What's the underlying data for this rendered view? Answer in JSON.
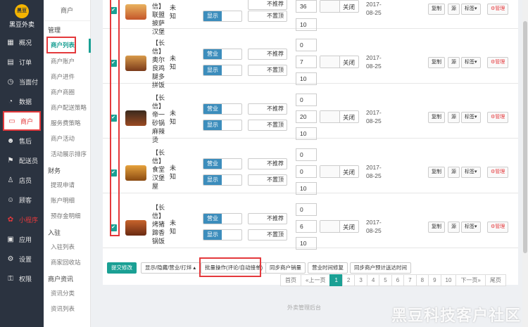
{
  "brand": {
    "logo_text": "黑豆",
    "name": "黑豆外卖"
  },
  "nav": [
    {
      "icon": "▦",
      "label": "概况"
    },
    {
      "icon": "▤",
      "label": "订单"
    },
    {
      "icon": "◷",
      "label": "当面付"
    },
    {
      "icon": "◔",
      "label": "数据"
    },
    {
      "icon": "▭",
      "label": "商户"
    },
    {
      "icon": "☻",
      "label": "售后"
    },
    {
      "icon": "⚑",
      "label": "配送员"
    },
    {
      "icon": "♙",
      "label": "店员"
    },
    {
      "icon": "☺",
      "label": "顾客"
    },
    {
      "icon": "✿",
      "label": "小程序"
    },
    {
      "icon": "▣",
      "label": "应用"
    },
    {
      "icon": "⚙",
      "label": "设置"
    },
    {
      "icon": "⚿",
      "label": "权限"
    }
  ],
  "sub": {
    "title": "商户",
    "groups": [
      {
        "label": "管理",
        "items": [
          "商户列表",
          "商户账户",
          "商户进件",
          "商户商圈",
          "商户配送策略",
          "服务费策略",
          "商户活动",
          "活动展示排序"
        ]
      },
      {
        "label": "财务",
        "items": [
          "提现申请",
          "账户明细",
          "预存金明细"
        ]
      },
      {
        "label": "入驻",
        "items": [
          "入驻列表",
          "商家回收站"
        ]
      },
      {
        "label": "商户资讯",
        "items": [
          "资讯分类",
          "资讯列表"
        ]
      }
    ]
  },
  "row0": {
    "name": "信】联盟披萨汉堡",
    "wz": "未知",
    "show": "显示",
    "top": "不置顶",
    "rec": "不推荐",
    "n1": "36",
    "n2": "10",
    "close": "关闭",
    "date": "2017-08-25",
    "b1": "复制",
    "b2": "源",
    "b3": "标签▾",
    "b4": "⚙管理"
  },
  "rows": [
    {
      "name": "【长信】奥尔良鸡腿多拼饭",
      "wz": "未知",
      "open": "营业",
      "rec": "不推荐",
      "show": "显示",
      "top": "不置顶",
      "n0": "0",
      "n1": "7",
      "n2": "10",
      "close": "关闭",
      "date": "2017-08-25"
    },
    {
      "name": "【长信】帝一砂锅麻辣烫",
      "wz": "未知",
      "open": "营业",
      "rec": "不推荐",
      "show": "显示",
      "top": "不置顶",
      "n0": "0",
      "n1": "20",
      "n2": "10",
      "close": "关闭",
      "date": "2017-08-25"
    },
    {
      "name": "【长信】食堂汉堡屋",
      "wz": "未知",
      "open": "营业",
      "rec": "不推荐",
      "show": "显示",
      "top": "不置顶",
      "n0": "0",
      "n1": "0",
      "n2": "10",
      "close": "关闭",
      "date": "2017-08-25"
    },
    {
      "name": "【长信】烤猪蹄香锅饭",
      "wz": "未知",
      "open": "营业",
      "rec": "不推荐",
      "show": "显示",
      "top": "不置顶",
      "n0": "0",
      "n1": "6",
      "n2": "10",
      "close": "关闭",
      "date": "2017-08-25"
    }
  ],
  "actions": {
    "copy": "复制",
    "source": "源",
    "tags": "标签▾",
    "manage": "⚙管理"
  },
  "toolbar": {
    "submit": "提交修改",
    "display": "显示/隐藏/营业/打烊 ▴",
    "batch": "批量操作(评论/自动接单)",
    "sync_sales": "同步商户销量",
    "fix_hours": "营业时间修复",
    "sync_time": "同步商户预计送达时间"
  },
  "pager": [
    "首页",
    "«上一页",
    "1",
    "2",
    "3",
    "4",
    "5",
    "6",
    "7",
    "8",
    "9",
    "10",
    "下一页»",
    "尾页"
  ],
  "footer": "外卖管理后台",
  "watermark": "黑豆科技客户社区",
  "colors": {
    "accent": "#1aa094",
    "highlight": "#e4393c",
    "sidebar": "#2b3340",
    "switch_on": "#3c8dbc"
  }
}
